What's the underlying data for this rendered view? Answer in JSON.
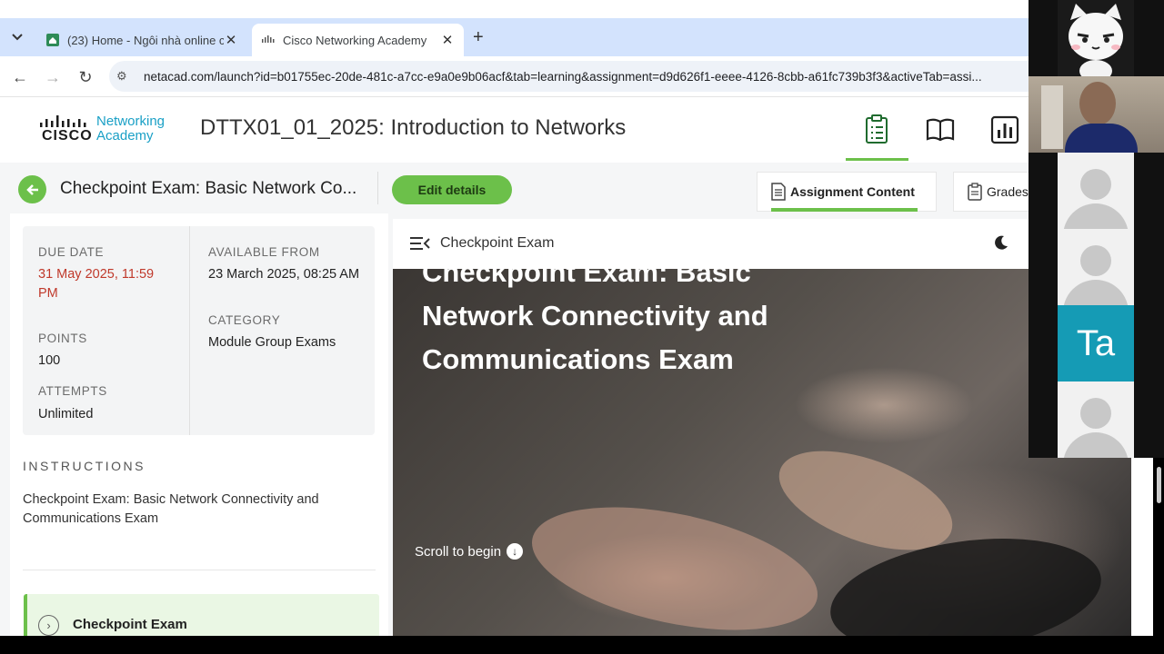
{
  "browser": {
    "tabs": [
      {
        "title": "(23) Home - Ngôi nhà online củ",
        "active": false
      },
      {
        "title": "Cisco Networking Academy",
        "active": true
      }
    ],
    "url": "netacad.com/launch?id=b01755ec-20de-481c-a7cc-e9a0e9b06acf&tab=learning&assignment=d9d626f1-eeee-4126-8cbb-a61fc739b3f3&activeTab=assi..."
  },
  "header": {
    "logo_brand": "CISCO",
    "logo_product": "Networking\nAcademy",
    "course_title": "DTTX01_01_2025: Introduction to Networks",
    "icons": [
      "assignments-icon",
      "book-icon",
      "chart-icon"
    ]
  },
  "subheader": {
    "exam_name": "Checkpoint Exam: Basic Network Co...",
    "edit_label": "Edit details",
    "tabs": [
      {
        "label": "Assignment Content",
        "active": true
      },
      {
        "label": "Grades",
        "active": false
      }
    ]
  },
  "details": {
    "due_label": "DUE DATE",
    "due_value": "31 May 2025, 11:59 PM",
    "available_label": "AVAILABLE FROM",
    "available_value": "23 March 2025, 08:25 AM",
    "points_label": "POINTS",
    "points_value": "100",
    "category_label": "CATEGORY",
    "category_value": "Module Group Exams",
    "attempts_label": "ATTEMPTS",
    "attempts_value": "Unlimited"
  },
  "instructions": {
    "label": "INSTRUCTIONS",
    "text": "Checkpoint Exam: Basic Network Connectivity and Communications Exam"
  },
  "outline": {
    "item_label": "Checkpoint Exam"
  },
  "content": {
    "header_title": "Checkpoint Exam",
    "hero_title": "Checkpoint Exam: Basic Network Connectivity and Communications Exam",
    "scroll_label": "Scroll to begin"
  },
  "call": {
    "participant_initials": "Ta"
  },
  "colors": {
    "accent_green": "#6cc04a",
    "due_red": "#c0392b",
    "cisco_blue": "#1aa0c6",
    "call_tile_teal": "#159bb5"
  }
}
